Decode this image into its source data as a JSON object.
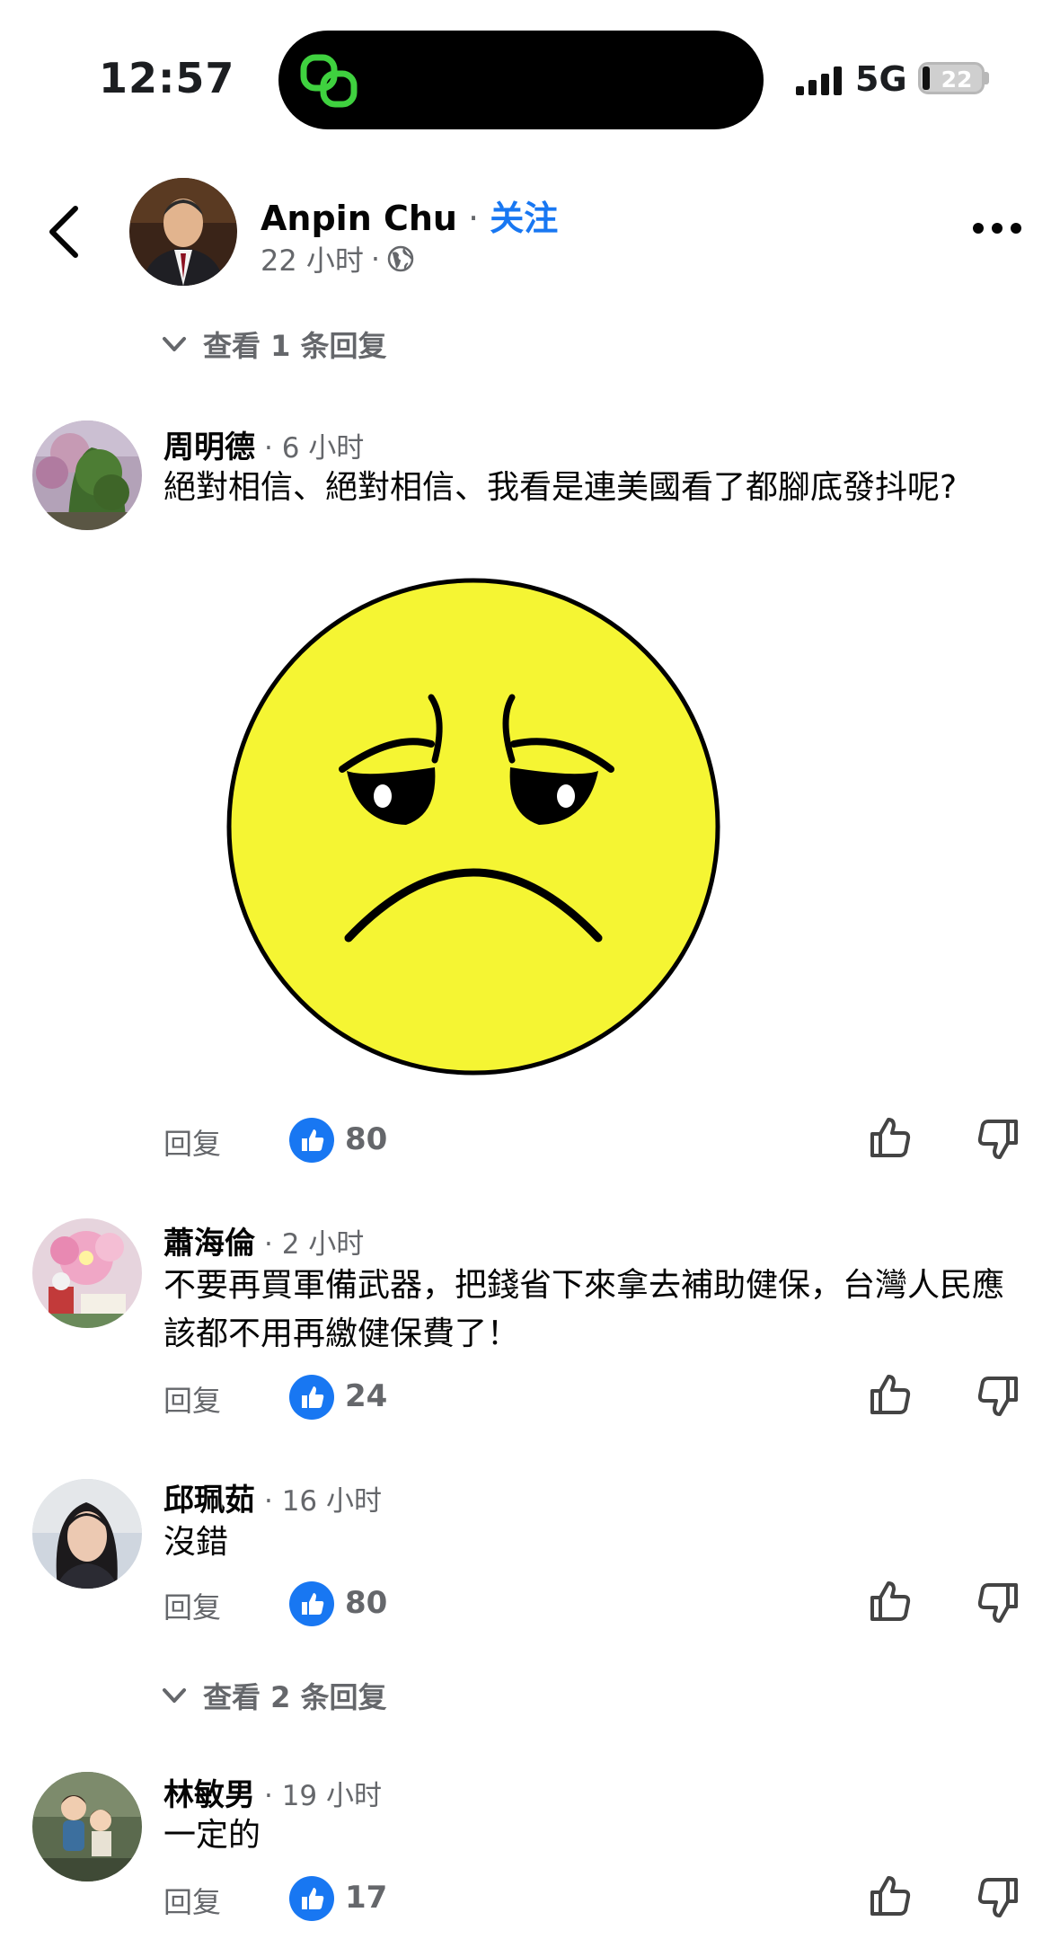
{
  "status_bar": {
    "time": "12:57",
    "network": "5G",
    "battery": "22"
  },
  "post_header": {
    "author": "Anpin Chu",
    "separator": " · ",
    "follow_label": "关注",
    "time": "22 小时",
    "meta_sep": "·",
    "privacy_icon": "globe-icon"
  },
  "top_replies_link": "查看 1 条回复",
  "comments": [
    {
      "name": "周明德",
      "time": "· 6 小时",
      "text": "絕對相信、絕對相信、我看是連美國看了都腳底發抖呢?",
      "reply": "回复",
      "likes": "80",
      "sticker": "sad-face-sticker"
    },
    {
      "name": "蕭海倫",
      "time": "· 2 小时",
      "text": "不要再買軍備武器，把錢省下來拿去補助健保，台灣人民應該都不用再繳健保費了！",
      "reply": "回复",
      "likes": "24"
    },
    {
      "name": "邱珮茹",
      "time": "· 16 小时",
      "text": "沒錯",
      "reply": "回复",
      "likes": "80",
      "replies_link": "查看 2 条回复"
    },
    {
      "name": "林敏男",
      "time": "· 19 小时",
      "text": "一定的",
      "reply": "回复",
      "likes": "17"
    }
  ],
  "colors": {
    "accent": "#1877f2",
    "secondary_text": "#65676b",
    "sticker_yellow": "#f5f533"
  }
}
